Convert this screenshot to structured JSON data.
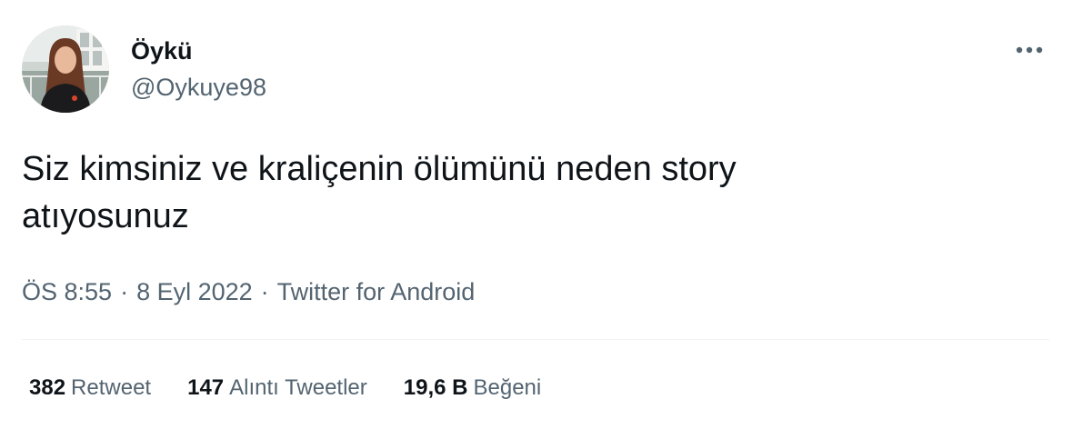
{
  "user": {
    "display_name": "Öykü",
    "handle": "@Oykuye98"
  },
  "tweet": {
    "text": "Siz kimsiniz ve kraliçenin ölümünü neden story\natıyosunuz",
    "time": "ÖS 8:55",
    "date": "8 Eyl 2022",
    "source": "Twitter for Android",
    "separator": "·"
  },
  "stats": {
    "retweets": {
      "count": "382",
      "label": "Retweet"
    },
    "quotes": {
      "count": "147",
      "label": "Alıntı Tweetler"
    },
    "likes": {
      "count": "19,6 B",
      "label": "Beğeni"
    }
  },
  "icons": {
    "more": "more-horizontal-icon",
    "avatar": "profile-photo"
  },
  "colors": {
    "text_primary": "#0f1419",
    "text_secondary": "#536471",
    "divider": "#eff3f4"
  }
}
